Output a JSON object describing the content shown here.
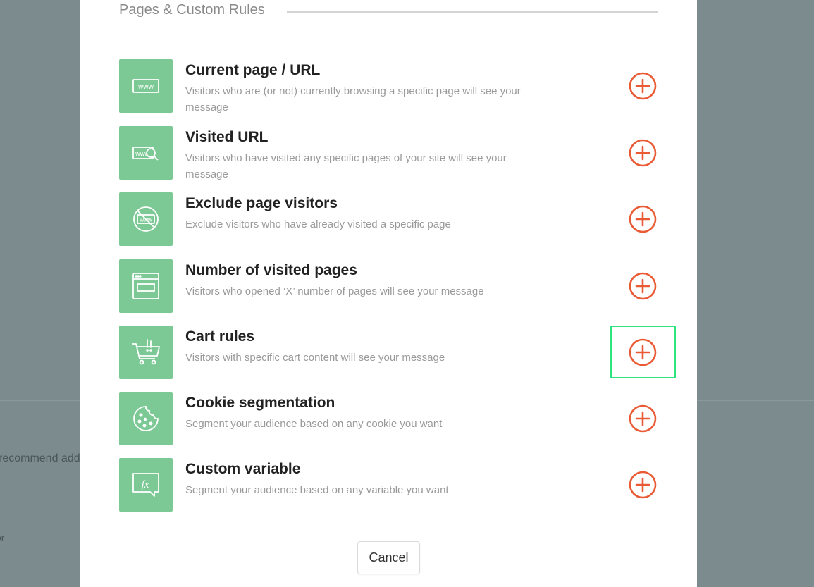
{
  "background": {
    "partial_text": "recommend add",
    "partial_text_2": "or"
  },
  "section": {
    "title": "Pages & Custom Rules"
  },
  "rules": [
    {
      "title": "Current page / URL",
      "description": "Visitors who are (or not) currently browsing a specific page will see your message",
      "icon": "www-icon"
    },
    {
      "title": "Visited URL",
      "description": "Visitors who have visited any specific pages of your site will see your message",
      "icon": "www-search-icon"
    },
    {
      "title": "Exclude page visitors",
      "description": "Exclude visitors who have already visited a specific page",
      "icon": "www-exclude-icon"
    },
    {
      "title": "Number of visited pages",
      "description": "Visitors who opened ‘X’ number of pages will see your message",
      "icon": "browser-window-icon"
    },
    {
      "title": "Cart rules",
      "description": "Visitors with specific cart content will see your message",
      "icon": "cart-alert-icon"
    },
    {
      "title": "Cookie segmentation",
      "description": "Segment your audience based on any cookie you want",
      "icon": "cookie-icon"
    },
    {
      "title": "Custom variable",
      "description": "Segment your audience based on any variable you want",
      "icon": "function-variable-icon"
    }
  ],
  "cancel_label": "Cancel",
  "colors": {
    "accent": "#e95a35",
    "icon_bg": "#7dc996",
    "highlight": "#2de57f",
    "overlay": "#7c8c8e"
  }
}
